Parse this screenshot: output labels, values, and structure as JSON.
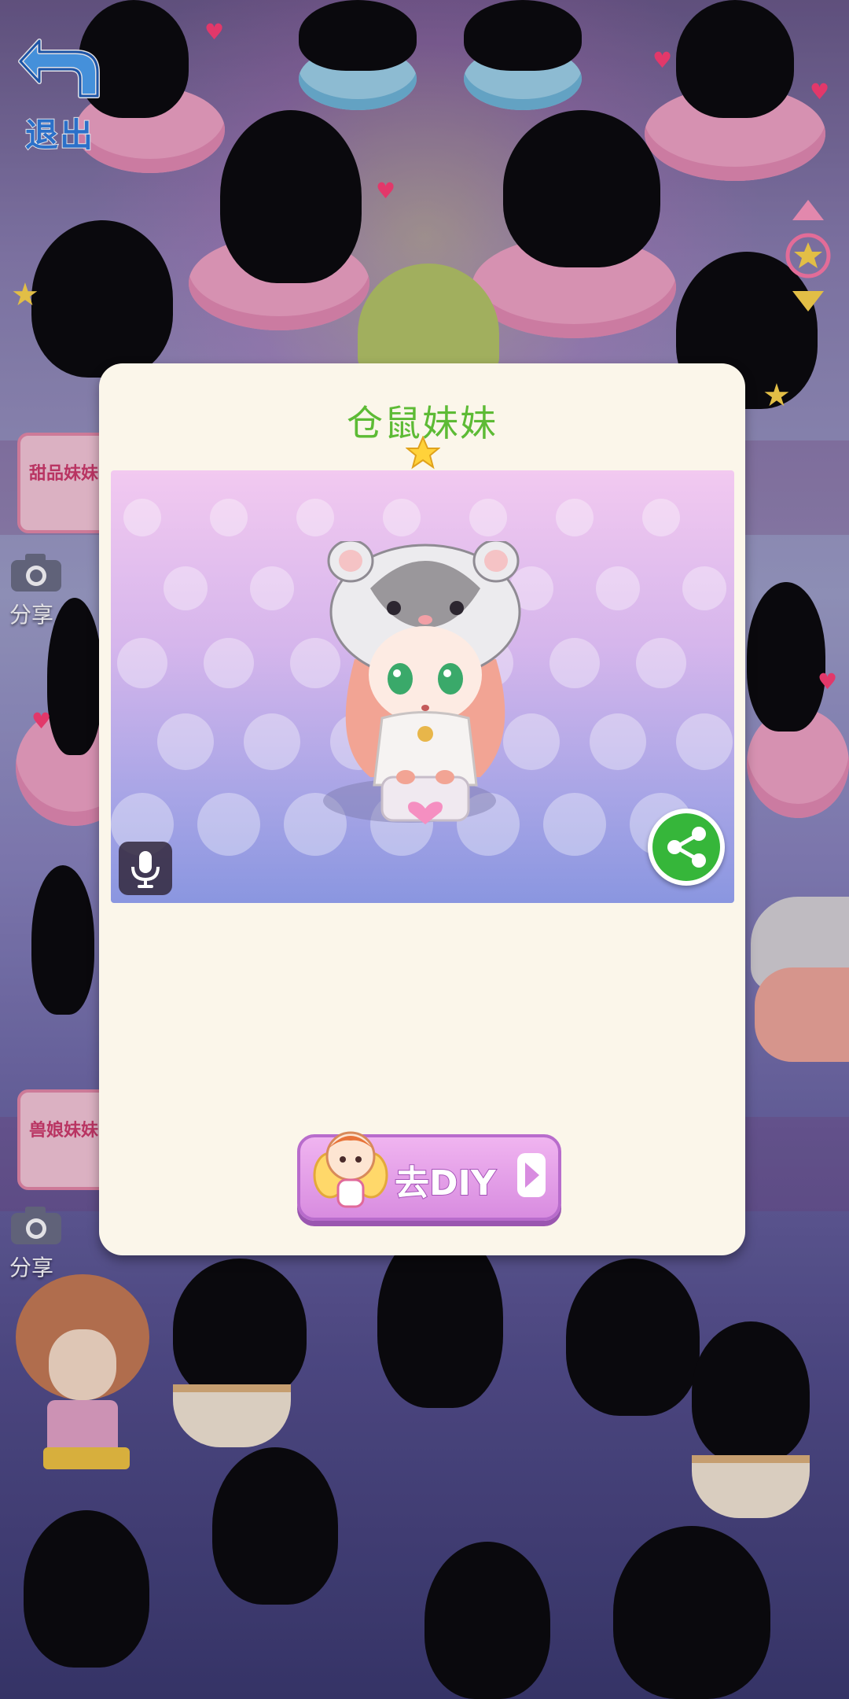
{
  "exit_button": {
    "label": "退出"
  },
  "side_panel": {
    "share_label_1": "分享",
    "share_label_2": "分享",
    "box_1_text": "甜品妹妹",
    "box_2_text": "兽娘妹妹"
  },
  "dialog": {
    "title": "仓鼠妹妹",
    "diy_button_label": "去DIY"
  },
  "colors": {
    "title_green": "#5dbb35",
    "share_green": "#36b63a",
    "diy_pink": "#d88ce0",
    "exit_blue": "#2f7fe0"
  },
  "icons": {
    "exit": "undo-arrow-icon",
    "rating": "star-icon",
    "mic": "microphone-icon",
    "share": "share-icon",
    "camera": "camera-icon",
    "diy_arrow": "play-arrow-icon"
  }
}
